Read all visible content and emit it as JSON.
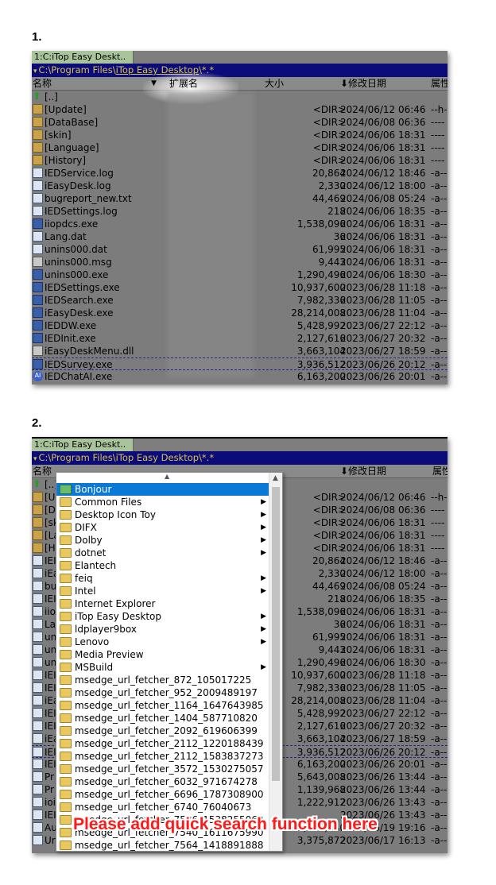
{
  "steps": [
    "1.",
    "2."
  ],
  "tab_label": "1:C:iTop Easy Deskt..",
  "path": {
    "arrow": "▾",
    "prefix": "C:\\Program Files\\",
    "highlight": "iTop Easy Desktop",
    "suffix": "\\*.*"
  },
  "columns": {
    "name": "名称",
    "ext": "扩展名",
    "size": "大小",
    "date": "⬇修改日期",
    "attr": "属性"
  },
  "files": [
    {
      "icon": "up-arrow-icon",
      "name": "[..]",
      "size": "",
      "date": "",
      "attr": ""
    },
    {
      "icon": "folder-icon",
      "name": "[Update]",
      "size": "<DIR>",
      "date": "2024/06/12 06:46",
      "attr": "--h-"
    },
    {
      "icon": "folder-icon",
      "name": "[DataBase]",
      "size": "<DIR>",
      "date": "2024/06/08 06:36",
      "attr": "----"
    },
    {
      "icon": "folder-icon",
      "name": "[skin]",
      "size": "<DIR>",
      "date": "2024/06/06 18:31",
      "attr": "----"
    },
    {
      "icon": "folder-icon",
      "name": "[Language]",
      "size": "<DIR>",
      "date": "2024/06/06 18:31",
      "attr": "----"
    },
    {
      "icon": "folder-icon",
      "name": "[History]",
      "size": "<DIR>",
      "date": "2024/06/06 18:31",
      "attr": "----"
    },
    {
      "icon": "file-icon",
      "name": "IEDService.log",
      "size": "20,864",
      "date": "2024/06/12 18:46",
      "attr": "-a--"
    },
    {
      "icon": "file-icon",
      "name": "iEasyDesk.log",
      "size": "2,330",
      "date": "2024/06/12 18:00",
      "attr": "-a--"
    },
    {
      "icon": "file-icon",
      "name": "bugreport_new.txt",
      "size": "44,469",
      "date": "2024/06/08 05:24",
      "attr": "-a--"
    },
    {
      "icon": "file-icon",
      "name": "IEDSettings.log",
      "size": "218",
      "date": "2024/06/06 18:35",
      "attr": "-a--"
    },
    {
      "icon": "exe-icon",
      "name": "iiopdcs.exe",
      "size": "1,538,096",
      "date": "2024/06/06 18:31",
      "attr": "-a--"
    },
    {
      "icon": "file-icon",
      "name": "Lang.dat",
      "size": "36",
      "date": "2024/06/06 18:31",
      "attr": "-a--"
    },
    {
      "icon": "file-icon",
      "name": "unins000.dat",
      "size": "61,995",
      "date": "2024/06/06 18:31",
      "attr": "-a--"
    },
    {
      "icon": "dat-icon",
      "name": "unins000.msg",
      "size": "9,443",
      "date": "2024/06/06 18:31",
      "attr": "-a--"
    },
    {
      "icon": "exe-icon",
      "name": "unins000.exe",
      "size": "1,290,496",
      "date": "2024/06/06 18:30",
      "attr": "-a--"
    },
    {
      "icon": "exe-icon",
      "name": "IEDSettings.exe",
      "size": "10,937,600",
      "date": "2023/06/28 11:18",
      "attr": "-a--"
    },
    {
      "icon": "exe-icon",
      "name": "IEDSearch.exe",
      "size": "7,982,336",
      "date": "2023/06/28 11:05",
      "attr": "-a--"
    },
    {
      "icon": "exe-icon",
      "name": "iEasyDesk.exe",
      "size": "28,214,008",
      "date": "2023/06/28 11:04",
      "attr": "-a--"
    },
    {
      "icon": "exe-icon",
      "name": "IEDDW.exe",
      "size": "5,428,992",
      "date": "2023/06/27 22:12",
      "attr": "-a--"
    },
    {
      "icon": "exe-icon",
      "name": "IEDInit.exe",
      "size": "2,127,616",
      "date": "2023/06/27 20:32",
      "attr": "-a--"
    },
    {
      "icon": "dat-icon",
      "name": "iEasyDeskMenu.dll",
      "size": "3,663,104",
      "date": "2023/06/27 18:59",
      "attr": "-a--"
    },
    {
      "icon": "exe-icon",
      "name": "IEDSurvey.exe",
      "size": "3,936,512",
      "date": "2023/06/26 20:12",
      "attr": "-a--"
    },
    {
      "icon": "ai-icon",
      "name": "IEDChatAI.exe",
      "size": "6,163,200",
      "date": "2023/06/26 20:01",
      "attr": "-a--"
    }
  ],
  "panel2_rows": [
    {
      "name": "[..]",
      "size": "",
      "date": "",
      "attr": ""
    },
    {
      "name": "[U",
      "size": "<DIR>",
      "date": "2024/06/12 06:46",
      "attr": "--h-"
    },
    {
      "name": "[D",
      "size": "<DIR>",
      "date": "2024/06/08 06:36",
      "attr": "----"
    },
    {
      "name": "[sk",
      "size": "<DIR>",
      "date": "2024/06/06 18:31",
      "attr": "----"
    },
    {
      "name": "[La",
      "size": "<DIR>",
      "date": "2024/06/06 18:31",
      "attr": "----"
    },
    {
      "name": "[H",
      "size": "<DIR>",
      "date": "2024/06/06 18:31",
      "attr": "----"
    },
    {
      "name": "IEI",
      "size": "20,864",
      "date": "2024/06/12 18:46",
      "attr": "-a--"
    },
    {
      "name": "iEa",
      "size": "2,330",
      "date": "2024/06/12 18:00",
      "attr": "-a--"
    },
    {
      "name": "bu",
      "size": "44,469",
      "date": "2024/06/08 05:24",
      "attr": "-a--"
    },
    {
      "name": "IEI",
      "size": "218",
      "date": "2024/06/06 18:35",
      "attr": "-a--"
    },
    {
      "name": "iio",
      "size": "1,538,096",
      "date": "2024/06/06 18:31",
      "attr": "-a--"
    },
    {
      "name": "La",
      "size": "36",
      "date": "2024/06/06 18:31",
      "attr": "-a--"
    },
    {
      "name": "un",
      "size": "61,995",
      "date": "2024/06/06 18:31",
      "attr": "-a--"
    },
    {
      "name": "un",
      "size": "9,443",
      "date": "2024/06/06 18:31",
      "attr": "-a--"
    },
    {
      "name": "un",
      "size": "1,290,496",
      "date": "2024/06/06 18:30",
      "attr": "-a--"
    },
    {
      "name": "IEI",
      "size": "10,937,600",
      "date": "2023/06/28 11:18",
      "attr": "-a--"
    },
    {
      "name": "IEI",
      "size": "7,982,336",
      "date": "2023/06/28 11:05",
      "attr": "-a--"
    },
    {
      "name": "iEa",
      "size": "28,214,008",
      "date": "2023/06/28 11:04",
      "attr": "-a--"
    },
    {
      "name": "IEI",
      "size": "5,428,992",
      "date": "2023/06/27 22:12",
      "attr": "-a--"
    },
    {
      "name": "IEI",
      "size": "2,127,616",
      "date": "2023/06/27 20:32",
      "attr": "-a--"
    },
    {
      "name": "iEa",
      "size": "3,663,104",
      "date": "2023/06/27 18:59",
      "attr": "-a--"
    },
    {
      "name": "IEI",
      "size": "3,936,512",
      "date": "2023/06/26 20:12",
      "attr": "-a--"
    },
    {
      "name": "IEI",
      "size": "6,163,200",
      "date": "2023/06/26 20:01",
      "attr": "-a--"
    },
    {
      "name": "Pr",
      "size": "5,643,008",
      "date": "2023/06/26 13:44",
      "attr": "-a--"
    },
    {
      "name": "Pr",
      "size": "1,139,968",
      "date": "2023/06/26 13:44",
      "attr": "-a--"
    },
    {
      "name": "ioi",
      "size": "1,222,912",
      "date": "2023/06/26 13:43",
      "attr": "-a--"
    },
    {
      "name": "IEI",
      "size": "",
      "date": "2023/06/26 13:43",
      "attr": "-a--"
    },
    {
      "name": "Au",
      "size": "3,050,240",
      "date": "2023/06/19 19:16",
      "attr": "-a--"
    },
    {
      "name": "Ur",
      "size": "3,375,872",
      "date": "2023/06/17 16:13",
      "attr": "-a--"
    }
  ],
  "dropdown_items": [
    {
      "label": "Bonjour",
      "submenu": false,
      "selected": true
    },
    {
      "label": "Common Files",
      "submenu": true
    },
    {
      "label": "Desktop Icon Toy",
      "submenu": true
    },
    {
      "label": "DIFX",
      "submenu": true
    },
    {
      "label": "Dolby",
      "submenu": true
    },
    {
      "label": "dotnet",
      "submenu": true
    },
    {
      "label": "Elantech",
      "submenu": false
    },
    {
      "label": "feiq",
      "submenu": true
    },
    {
      "label": "Intel",
      "submenu": true
    },
    {
      "label": "Internet Explorer",
      "submenu": false
    },
    {
      "label": "iTop Easy Desktop",
      "submenu": true
    },
    {
      "label": "ldplayer9box",
      "submenu": true
    },
    {
      "label": "Lenovo",
      "submenu": true
    },
    {
      "label": "Media Preview",
      "submenu": false
    },
    {
      "label": "MSBuild",
      "submenu": true
    },
    {
      "label": "msedge_url_fetcher_872_105017225",
      "submenu": false
    },
    {
      "label": "msedge_url_fetcher_952_2009489197",
      "submenu": false
    },
    {
      "label": "msedge_url_fetcher_1164_1647643985",
      "submenu": false
    },
    {
      "label": "msedge_url_fetcher_1404_587710820",
      "submenu": false
    },
    {
      "label": "msedge_url_fetcher_2092_619606399",
      "submenu": false
    },
    {
      "label": "msedge_url_fetcher_2112_1220188439",
      "submenu": false
    },
    {
      "label": "msedge_url_fetcher_2112_1583837273",
      "submenu": false
    },
    {
      "label": "msedge_url_fetcher_3572_1530275057",
      "submenu": false
    },
    {
      "label": "msedge_url_fetcher_6032_971674278",
      "submenu": false
    },
    {
      "label": "msedge_url_fetcher_6696_1787308900",
      "submenu": false
    },
    {
      "label": "msedge_url_fetcher_6740_76040673",
      "submenu": false
    },
    {
      "label": "msedge_url_fetcher_7536_1538255063",
      "submenu": false
    },
    {
      "label": "msedge_url_fetcher_7540_1611675990",
      "submenu": false
    },
    {
      "label": "msedge_url_fetcher_7564_1418891888",
      "submenu": false
    }
  ],
  "overlay_note": "Please add quick search function here",
  "colors": {
    "accent": "#0a78d7",
    "path_bg": "#0b0b7a",
    "path_text": "#d7c24a",
    "tab_bg": "#a9c49a",
    "note": "#ff1a1a"
  }
}
